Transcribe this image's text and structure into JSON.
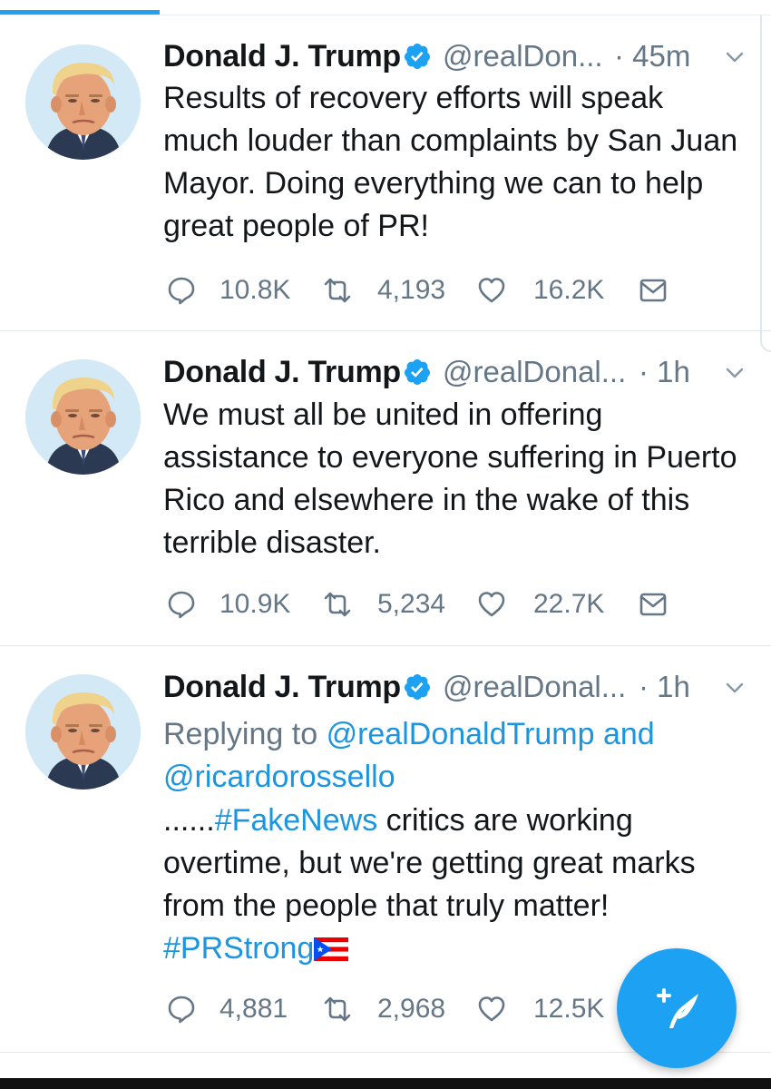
{
  "tweets": [
    {
      "name": "Donald J. Trump",
      "handle": "@realDon...",
      "time": "· 45m",
      "text": "Results of recovery efforts will speak much louder than complaints by San Juan Mayor. Doing everything we can to help great people of PR!",
      "replies": "10.8K",
      "retweets": "4,193",
      "likes": "16.2K"
    },
    {
      "name": "Donald J. Trump",
      "handle": "@realDonal...",
      "time": "· 1h",
      "text": "We must all be united in offering assistance to everyone suffering in Puerto Rico and elsewhere in the wake of this terrible disaster.",
      "replies": "10.9K",
      "retweets": "5,234",
      "likes": "22.7K"
    },
    {
      "name": "Donald J. Trump",
      "handle": "@realDonal...",
      "time": "· 1h",
      "reply_prefix": "Replying to",
      "reply_user1": "@realDonaldTrump",
      "reply_and": "and",
      "reply_user2": "@ricardorossello",
      "text_dots": "......",
      "hashtag1": "#FakeNews",
      "text_rest": "critics are working overtime, but we're getting great marks from the people that truly matter!",
      "hashtag2": "#PRStrong",
      "replies": "4,881",
      "retweets": "2,968",
      "likes": "12.5K"
    }
  ],
  "icons": {
    "reply": "reply-icon",
    "retweet": "retweet-icon",
    "like": "heart-icon",
    "dm": "envelope-icon",
    "verified": "verified-badge-icon",
    "compose": "compose-tweet-icon",
    "more": "chevron-down-icon"
  },
  "colors": {
    "accent": "#1da1f2",
    "link": "#1b95e0",
    "secondary_text": "#657786",
    "primary_text": "#14171a"
  }
}
